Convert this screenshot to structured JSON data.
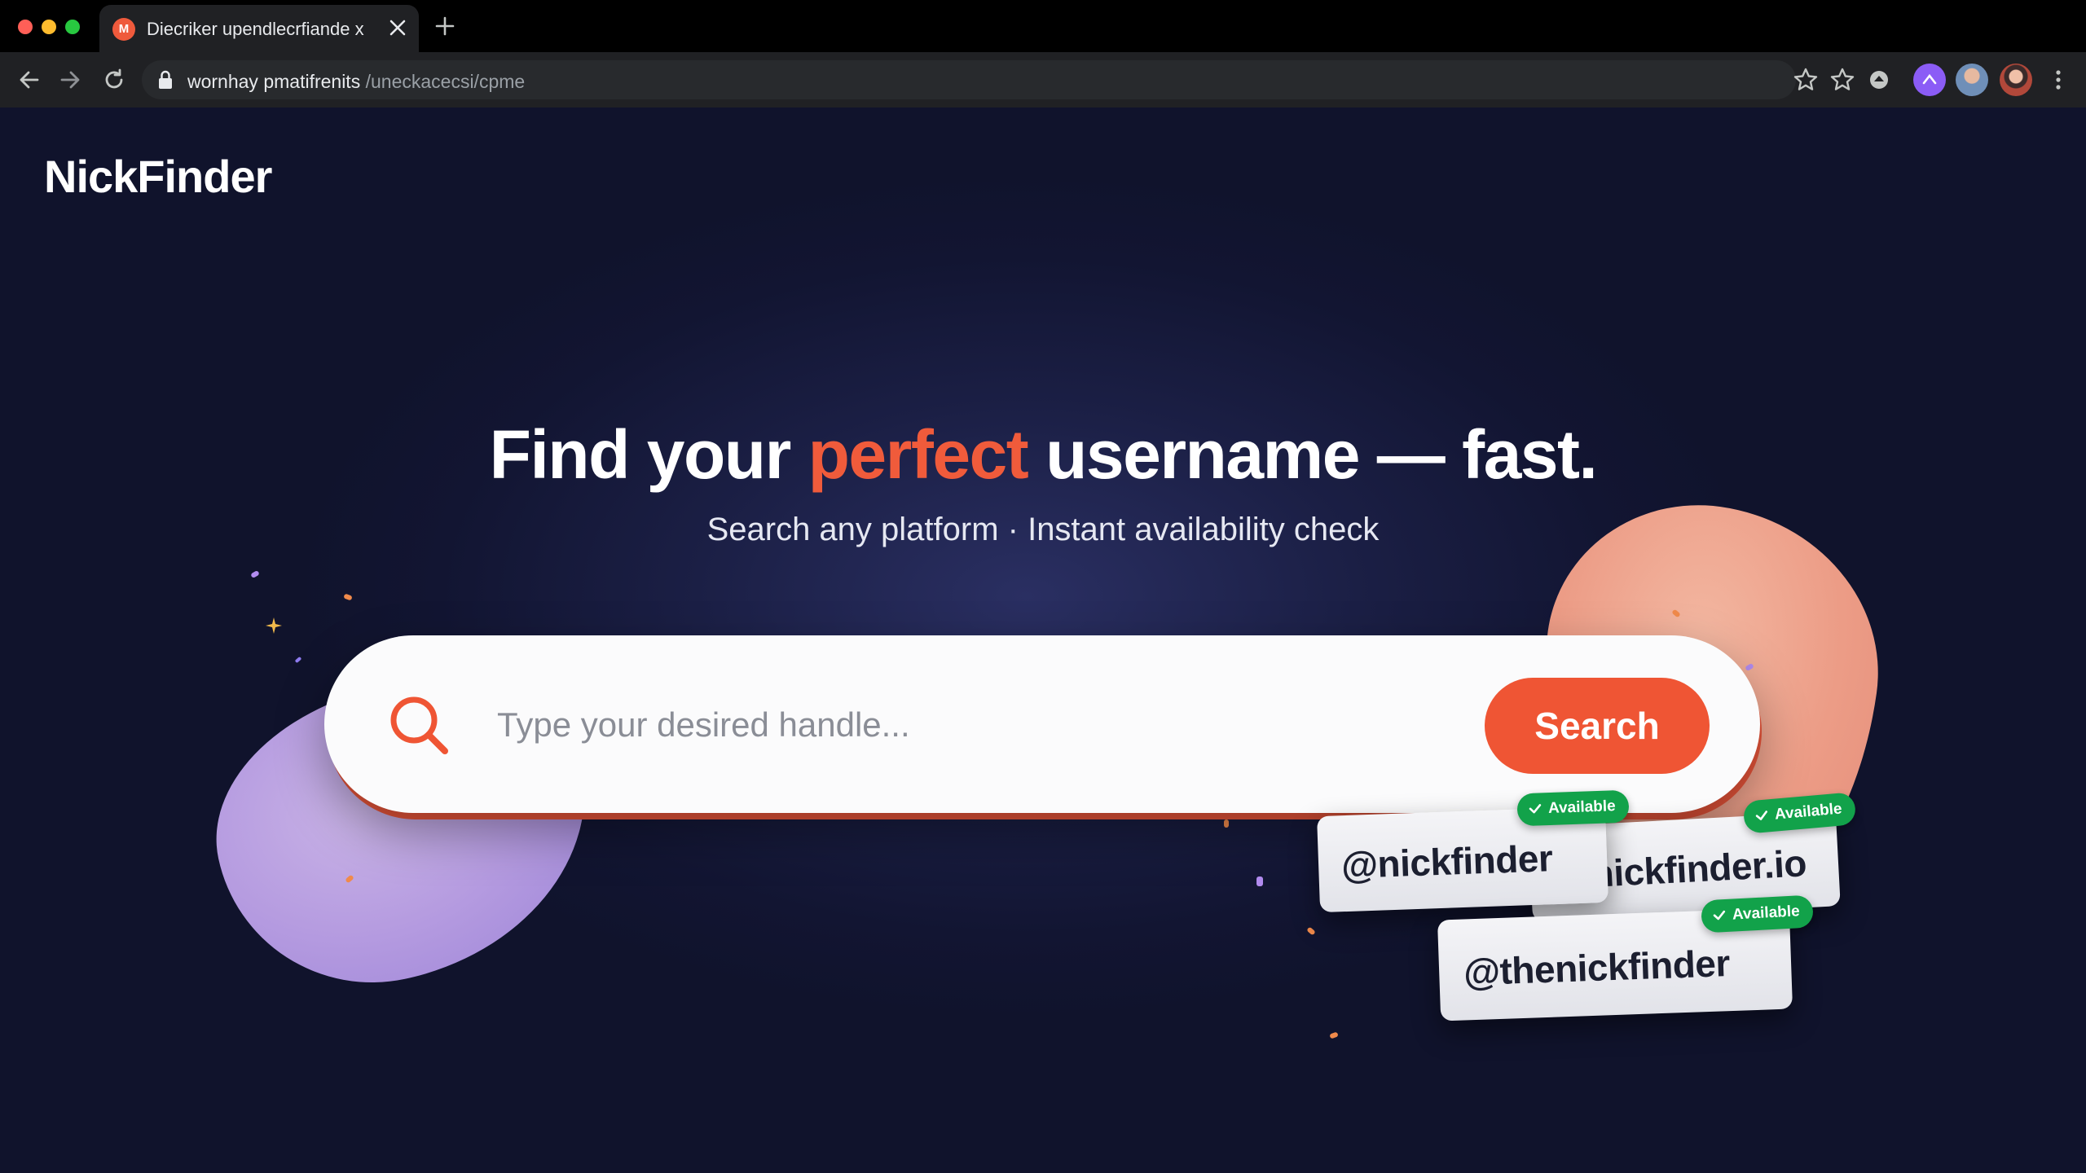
{
  "browser": {
    "tab_title": "Diecriker upendlecrfiande x",
    "url_host": "wornhay pmatifrenits",
    "url_path": " /uneck​acecsi/cpme"
  },
  "brand": {
    "logo": "NickFinder"
  },
  "hero": {
    "headline_pre": "Find your ",
    "headline_accent": "perfect",
    "headline_post": " username — fast.",
    "subhead": "Search any platform · Instant availability check"
  },
  "search": {
    "placeholder": "Type your desired handle...",
    "button_label": "Search"
  },
  "results": [
    {
      "handle": "@nickfinder",
      "status": "Available"
    },
    {
      "handle": "@nickfinder.io",
      "status": "Available"
    },
    {
      "handle": "@thenickfinder",
      "status": "Available"
    }
  ],
  "colors": {
    "accent": "#ef5534",
    "available": "#12a24a",
    "background": "#10142a"
  },
  "icons": [
    "close-icon",
    "plus-icon",
    "back-arrow-icon",
    "forward-arrow-icon",
    "reload-icon",
    "lock-icon",
    "star-icon",
    "bookmark-star-icon",
    "extension-icon",
    "search-icon",
    "check-icon"
  ]
}
